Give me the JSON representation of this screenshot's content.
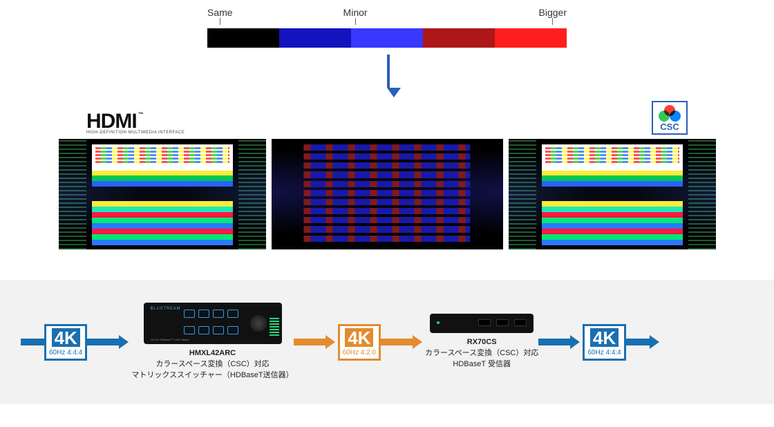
{
  "colorbar": {
    "labels": [
      "Same",
      "Minor",
      "Bigger"
    ],
    "segments": [
      {
        "color": "#000000"
      },
      {
        "color": "#1414bf"
      },
      {
        "color": "#3838ff"
      },
      {
        "color": "#ad1717"
      },
      {
        "color": "#ff1e1e"
      }
    ]
  },
  "logos": {
    "hdmi_text": "HDMI",
    "hdmi_tm": "™",
    "hdmi_sub": "HIGH-DEFINITION MULTIMEDIA INTERFACE",
    "csc_text": "CSC"
  },
  "screens": {
    "panel_bands": [
      "#ffeb3b",
      "#00c853",
      "#2962ff"
    ],
    "stripes": [
      "#ffeb3b",
      "#1de9b6",
      "#ff1744",
      "#00e676",
      "#2979ff",
      "#ff1744",
      "#00e676",
      "#2979ff"
    ]
  },
  "flow": {
    "badge_text": "4K",
    "badge1_sub": "60Hz 4:4:4",
    "badge_mid_sub": "60Hz 4:2:0",
    "badge3_sub": "60Hz 4:4:4",
    "matrix": {
      "name": "HMXL42ARC",
      "line1": "カラースペース変換（CSC）対応",
      "line2": "マトリックススイッチャー（HDBaseT送信器）",
      "brand": "BLUSTREAM",
      "sub": "4x2 4K HDBaseT™ ARC Matrix"
    },
    "rx": {
      "name": "RX70CS",
      "line1": "カラースペース変換（CSC）対応",
      "line2": "HDBaseT  受信器"
    }
  }
}
